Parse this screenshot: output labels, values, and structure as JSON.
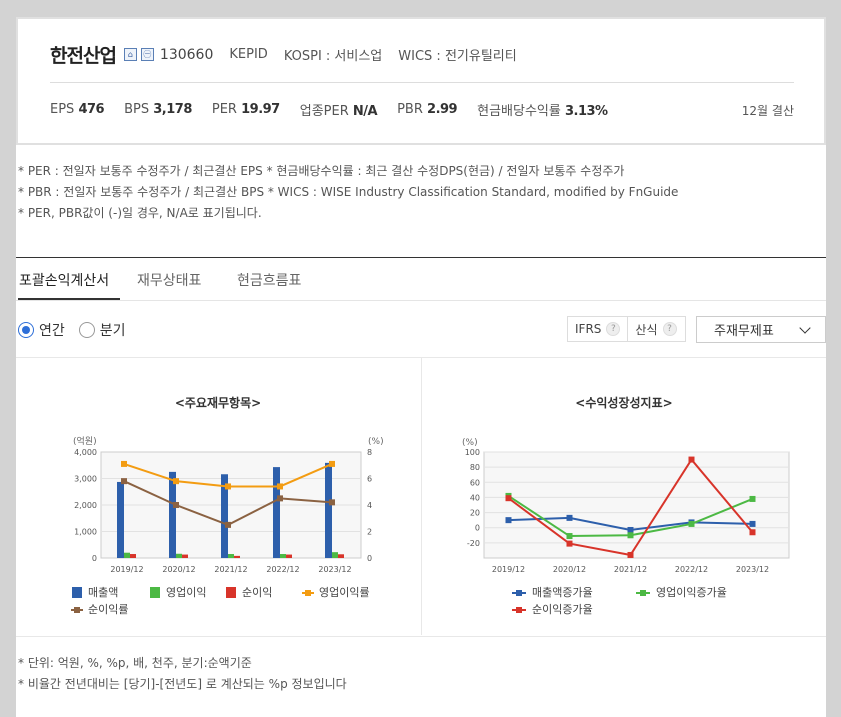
{
  "company": {
    "name": "한전산업",
    "badge1": "⌂",
    "badge2": "㊀",
    "code": "130660",
    "ticker": "KEPID",
    "market": "KOSPI : 서비스업",
    "wics": "WICS : 전기유틸리티"
  },
  "metrics": [
    {
      "label": "EPS",
      "value": "476"
    },
    {
      "label": "BPS",
      "value": "3,178"
    },
    {
      "label": "PER",
      "value": "19.97"
    },
    {
      "label": "업종PER",
      "value": "N/A"
    },
    {
      "label": "PBR",
      "value": "2.99"
    },
    {
      "label": "현금배당수익률",
      "value": "3.13%"
    }
  ],
  "settlement": "12월 결산",
  "notes": [
    "* PER : 전일자 보통주 수정주가 / 최근결산 EPS * 현금배당수익률 : 최근 결산 수정DPS(현금) / 전일자 보통주 수정주가",
    "* PBR : 전일자 보통주 수정주가 / 최근결산 BPS * WICS : WISE Industry Classification Standard, modified by FnGuide",
    "* PER, PBR값이 (-)일 경우, N/A로 표기됩니다."
  ],
  "tabs": [
    "포괄손익계산서",
    "재무상태표",
    "현금흐름표"
  ],
  "period": {
    "annual": "연간",
    "quarter": "분기"
  },
  "controls": {
    "ifrs": "IFRS",
    "formula": "산식",
    "help": "?",
    "select": "주재무제표"
  },
  "colors": {
    "blue": "#2d5fab",
    "green": "#4cb944",
    "red": "#d8342a",
    "orange": "#f39c12",
    "brown": "#8b6242"
  },
  "chart_data": [
    {
      "type": "bar",
      "title": "<주요재무항목>",
      "ylabel": "(억원)",
      "y2label": "(%)",
      "categories": [
        "2019/12",
        "2020/12",
        "2021/12",
        "2022/12",
        "2023/12"
      ],
      "ylim": [
        0,
        4000
      ],
      "y2lim": [
        0,
        8
      ],
      "yticks": [
        "0",
        "1,000",
        "2,000",
        "3,000",
        "4,000"
      ],
      "y2ticks": [
        "0",
        "2",
        "4",
        "6",
        "8"
      ],
      "series": [
        {
          "name": "매출액",
          "kind": "bar",
          "values": [
            2870,
            3250,
            3160,
            3430,
            3590
          ]
        },
        {
          "name": "영업이익",
          "kind": "bar",
          "values": [
            200,
            160,
            150,
            150,
            220
          ]
        },
        {
          "name": "순이익",
          "kind": "bar",
          "values": [
            150,
            130,
            80,
            130,
            140
          ]
        },
        {
          "name": "영업이익률",
          "kind": "line",
          "axis": "right",
          "values": [
            7.1,
            5.8,
            5.4,
            5.4,
            7.1
          ]
        },
        {
          "name": "순이익률",
          "kind": "line",
          "axis": "right",
          "values": [
            5.8,
            4.0,
            2.5,
            4.5,
            4.2
          ]
        }
      ],
      "legend": "bottom"
    },
    {
      "type": "line",
      "title": "<수익성장성지표>",
      "ylabel": "(%)",
      "categories": [
        "2019/12",
        "2020/12",
        "2021/12",
        "2022/12",
        "2023/12"
      ],
      "ylim": [
        -40,
        100
      ],
      "yticks": [
        "-20",
        "0",
        "20",
        "40",
        "60",
        "80",
        "100"
      ],
      "series": [
        {
          "name": "매출액증가율",
          "values": [
            10,
            13,
            -3,
            7,
            5
          ]
        },
        {
          "name": "영업이익증가율",
          "values": [
            42,
            -11,
            -10,
            5,
            38
          ]
        },
        {
          "name": "순이익증가율",
          "values": [
            39,
            -21,
            -36,
            90,
            -6
          ]
        }
      ],
      "legend": "bottom"
    }
  ],
  "footnotes": [
    "* 단위: 억원, %, %p, 배, 천주, 분기:순액기준",
    "* 비율간 전년대비는 [당기]-[전년도] 로 계산되는 %p 정보입니다"
  ]
}
